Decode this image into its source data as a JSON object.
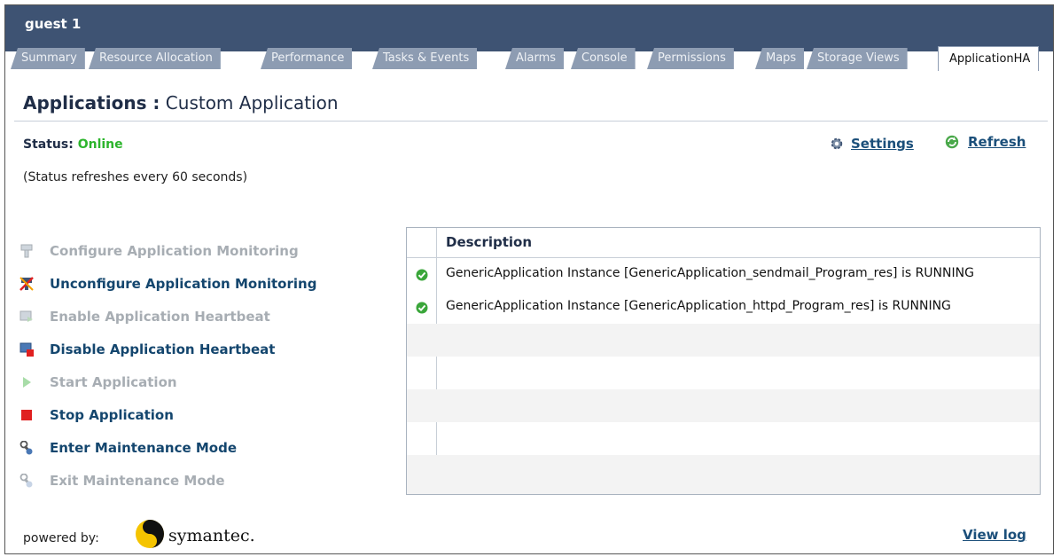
{
  "window": {
    "title": "guest 1"
  },
  "tabs": [
    {
      "label": "Summary"
    },
    {
      "label": "Resource Allocation"
    },
    {
      "label": "Performance"
    },
    {
      "label": "Tasks & Events"
    },
    {
      "label": "Alarms"
    },
    {
      "label": "Console"
    },
    {
      "label": "Permissions"
    },
    {
      "label": "Maps"
    },
    {
      "label": "Storage Views"
    },
    {
      "label": "ApplicationHA",
      "active": true
    }
  ],
  "header": {
    "title_bold": "Applications :",
    "title_rest": "Custom Application"
  },
  "status": {
    "label": "Status:",
    "value": "Online",
    "note": "(Status refreshes every 60 seconds)"
  },
  "links": {
    "settings": "Settings",
    "refresh": "Refresh",
    "view_log": "View log"
  },
  "actions": [
    {
      "label": "Configure Application Monitoring",
      "enabled": false,
      "icon": "configure-icon"
    },
    {
      "label": "Unconfigure Application Monitoring",
      "enabled": true,
      "icon": "unconfigure-icon"
    },
    {
      "label": "Enable Application Heartbeat",
      "enabled": false,
      "icon": "enable-heartbeat-icon"
    },
    {
      "label": "Disable Application Heartbeat",
      "enabled": true,
      "icon": "disable-heartbeat-icon"
    },
    {
      "label": "Start Application",
      "enabled": false,
      "icon": "play-icon"
    },
    {
      "label": "Stop Application",
      "enabled": true,
      "icon": "stop-icon"
    },
    {
      "label": "Enter Maintenance Mode",
      "enabled": true,
      "icon": "wrench-icon"
    },
    {
      "label": "Exit Maintenance Mode",
      "enabled": false,
      "icon": "wrench-icon"
    }
  ],
  "table": {
    "header": "Description",
    "rows": [
      {
        "status_icon": "check-icon",
        "description": "GenericApplication Instance [GenericApplication_sendmail_Program_res] is RUNNING"
      },
      {
        "status_icon": "check-icon",
        "description": "GenericApplication Instance [GenericApplication_httpd_Program_res] is RUNNING"
      }
    ]
  },
  "footer": {
    "powered_by": "powered by:",
    "brand": "symantec."
  },
  "colors": {
    "titlebar": "#3e5373",
    "tab": "#8d9cb2",
    "online": "#2db52d",
    "link": "#1b4f7a",
    "disabled": "#a7adb3",
    "stop": "#e02020"
  }
}
